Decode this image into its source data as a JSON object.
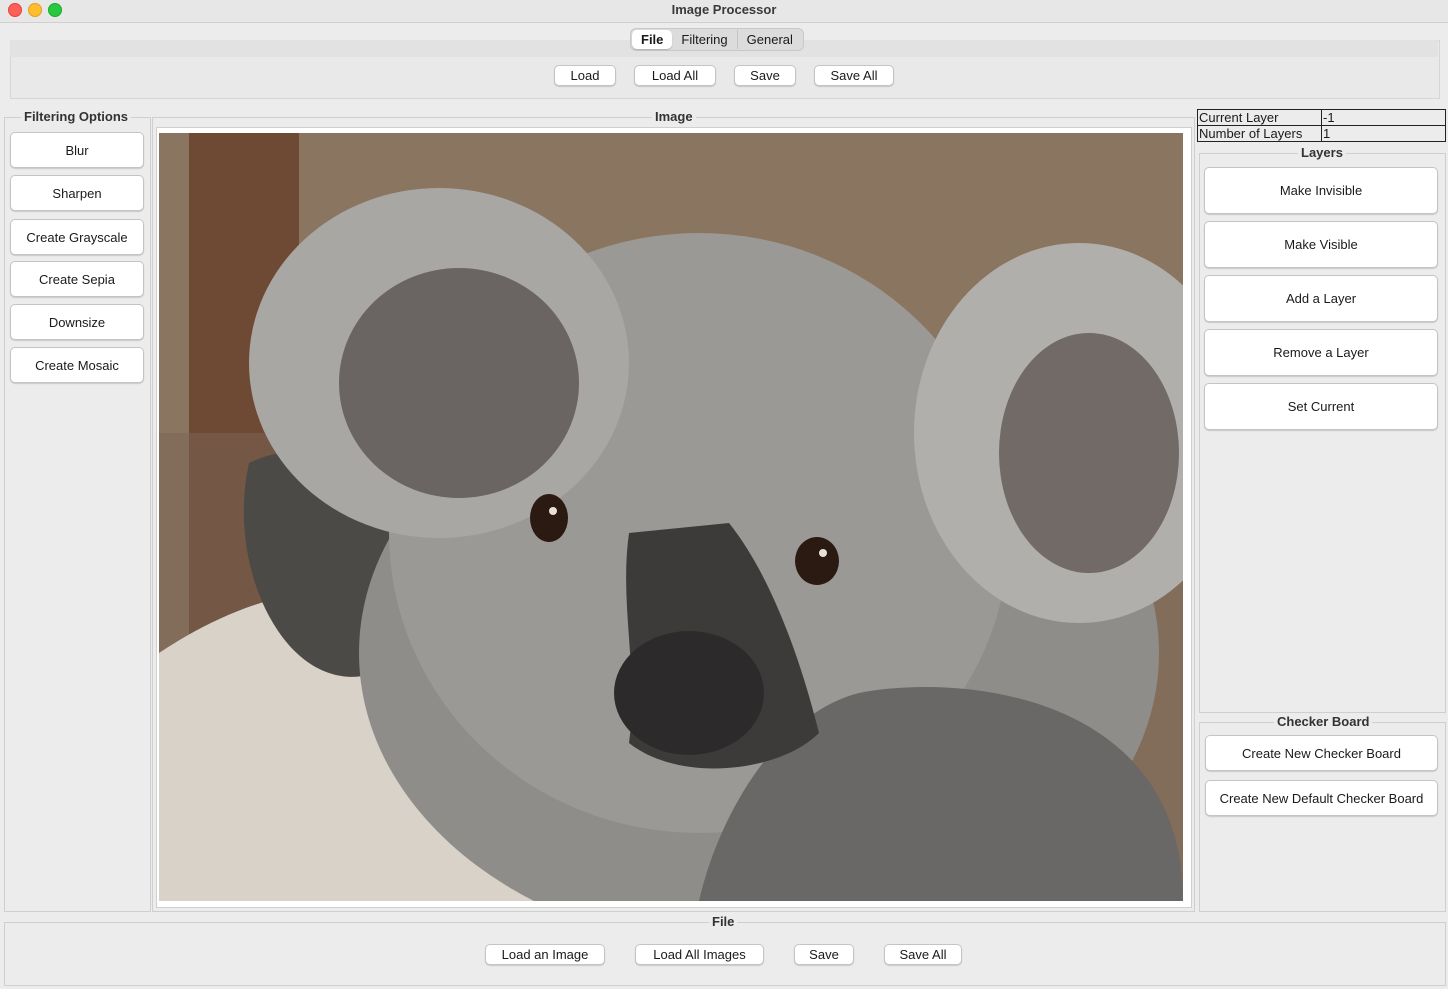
{
  "window": {
    "title": "Image Processor"
  },
  "top_tabs": [
    "File",
    "Filtering",
    "General"
  ],
  "top_buttons": [
    "Load",
    "Load All",
    "Save",
    "Save All"
  ],
  "filtering": {
    "title": "Filtering Options",
    "buttons": [
      "Blur",
      "Sharpen",
      "Create Grayscale",
      "Create Sepia",
      "Downsize",
      "Create Mosaic"
    ]
  },
  "image_panel": {
    "title": "Image"
  },
  "info": {
    "current_label": "Current Layer",
    "current_value": "-1",
    "number_label": "Number of Layers",
    "number_value": "1"
  },
  "layers": {
    "title": "Layers",
    "buttons": [
      "Make Invisible",
      "Make Visible",
      "Add a Layer",
      "Remove a Layer",
      "Set Current"
    ]
  },
  "checker": {
    "title": "Checker Board",
    "buttons": [
      "Create New Checker Board",
      "Create New Default Checker Board"
    ]
  },
  "bottom_file": {
    "title": "File",
    "buttons": [
      "Load an Image",
      "Load All Images",
      "Save",
      "Save All"
    ]
  }
}
